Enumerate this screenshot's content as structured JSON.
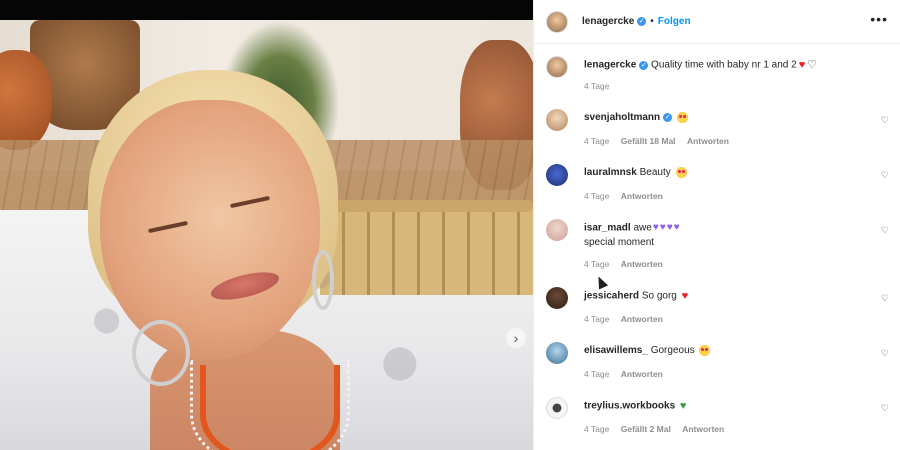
{
  "post": {
    "owner": "lenagercke",
    "follow_label": "Folgen",
    "separator": "•",
    "more_label": "•••",
    "caption": "Quality time with baby nr 1 and 2",
    "caption_age": "4 Tage",
    "next_label": "›"
  },
  "comments": [
    {
      "user": "svenjaholtmann",
      "verified": true,
      "text": "",
      "age": "4 Tage",
      "likes": "Gefällt 18 Mal",
      "reply": "Antworten"
    },
    {
      "user": "lauralmnsk",
      "verified": false,
      "text": "Beauty",
      "age": "4 Tage",
      "likes": "",
      "reply": "Antworten"
    },
    {
      "user": "isar_madl",
      "verified": false,
      "text": "awe",
      "text2": "special moment",
      "age": "4 Tage",
      "likes": "",
      "reply": "Antworten"
    },
    {
      "user": "jessicaherd",
      "verified": false,
      "text": "So gorg",
      "age": "4 Tage",
      "likes": "",
      "reply": "Antworten"
    },
    {
      "user": "elisawillems_",
      "verified": false,
      "text": "Gorgeous",
      "age": "4 Tage",
      "likes": "",
      "reply": "Antworten"
    },
    {
      "user": "treylius.workbooks",
      "verified": false,
      "text": "",
      "age": "4 Tage",
      "likes": "Gefällt 2 Mal",
      "reply": "Antworten"
    }
  ],
  "icons": {
    "verified": "✓",
    "like": "♡",
    "red_heart": "♥",
    "white_heart": "♡",
    "purple_heart": "♥",
    "green_heart": "♥"
  },
  "colors": {
    "follow": "#0095f6",
    "verified": "#3897f0",
    "meta": "#8e8e8e"
  }
}
